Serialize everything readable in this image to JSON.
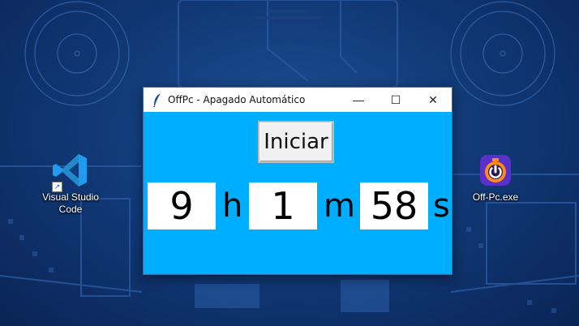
{
  "window": {
    "title": "OffPc - Apagado Automático",
    "minimize": "—",
    "maximize": "☐",
    "close": "✕"
  },
  "controls": {
    "start_label": "Iniciar"
  },
  "timer": {
    "hours": "9",
    "hours_unit": "h",
    "minutes": "1",
    "minutes_unit": "m",
    "seconds": "58",
    "seconds_unit": "s"
  },
  "desktop": {
    "icons": [
      {
        "label": "Visual Studio Code",
        "icon": "vscode-icon"
      },
      {
        "label": "Off-Pc.exe",
        "icon": "power-timer-icon"
      }
    ]
  },
  "colors": {
    "window_bg": "#00aeff",
    "desktop_bg": "#113a78"
  }
}
